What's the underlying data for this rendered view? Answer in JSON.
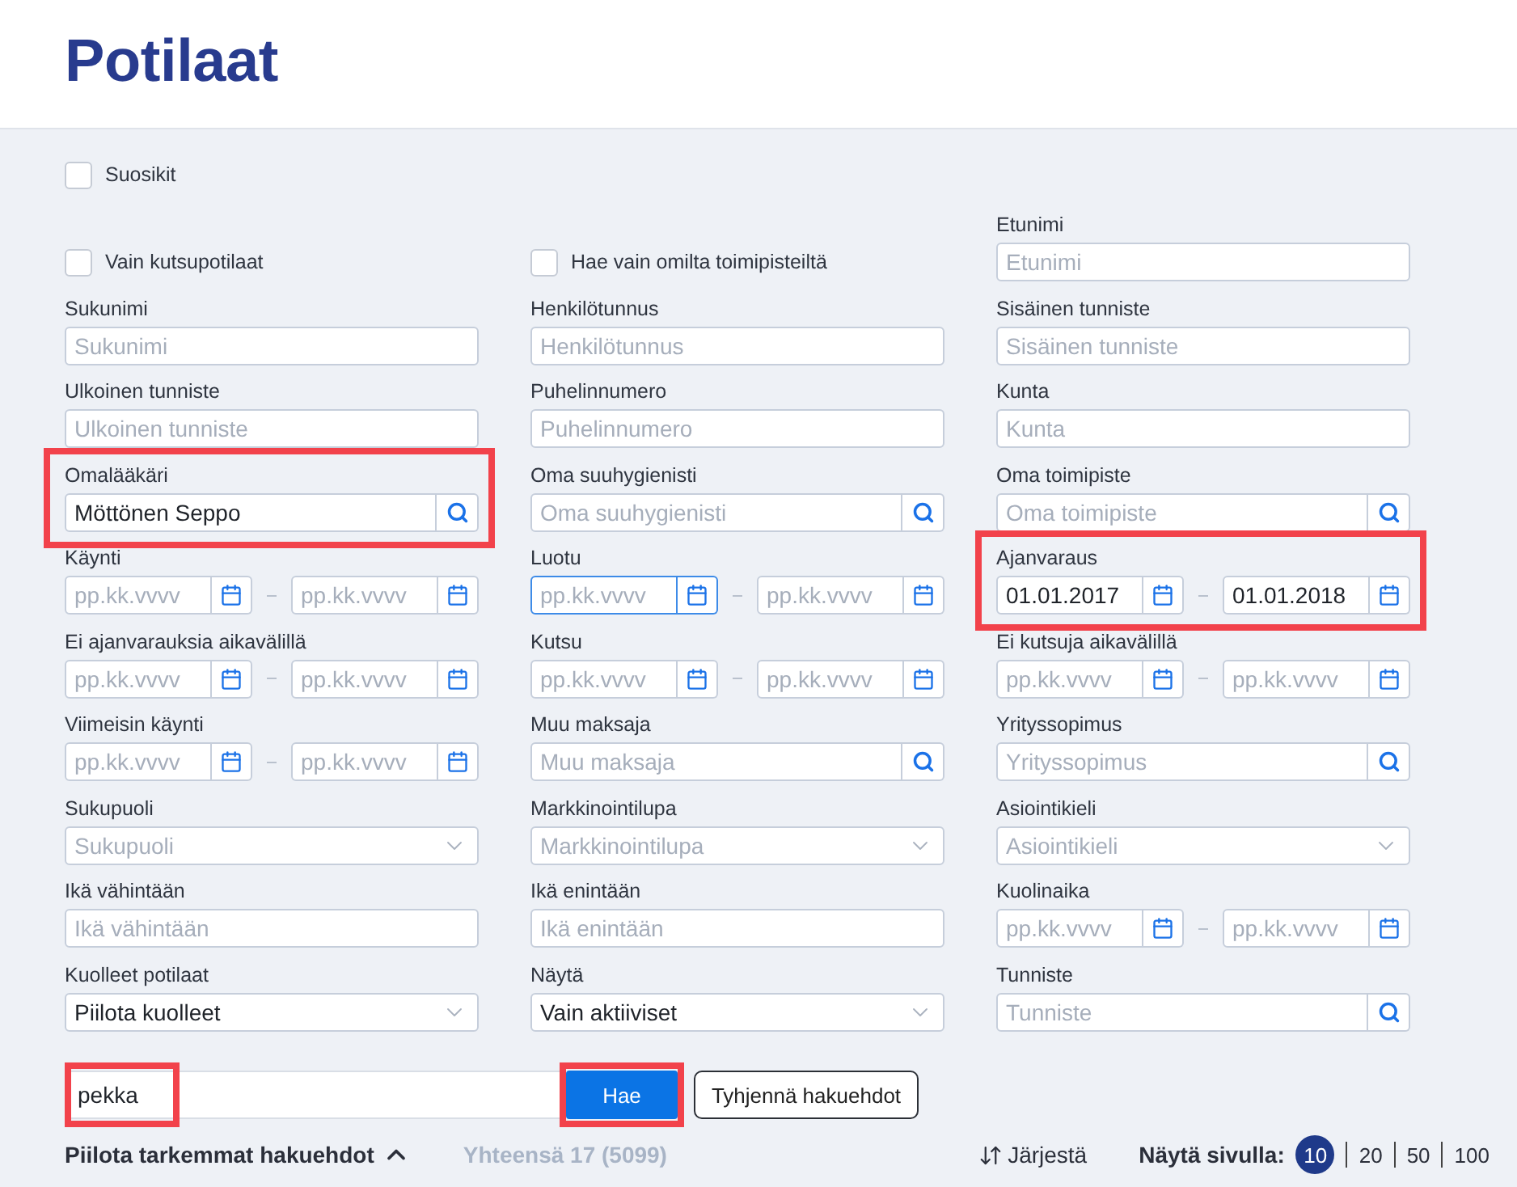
{
  "header": {
    "title": "Potilaat"
  },
  "filters": {
    "rows": [
      [
        {
          "kind": "checkbox",
          "label": "Suosikit",
          "checked": false,
          "highlighted": false
        }
      ],
      [
        {
          "kind": "checkbox",
          "label": "Vain kutsupotilaat",
          "checked": false,
          "highlighted": false
        },
        {
          "kind": "checkbox",
          "label": "Hae vain omilta toimipisteiltä",
          "checked": false,
          "highlighted": false
        },
        {
          "kind": "text",
          "label": "Etunimi",
          "placeholder": "Etunimi",
          "highlighted": false
        }
      ],
      [
        {
          "kind": "text",
          "label": "Sukunimi",
          "placeholder": "Sukunimi",
          "highlighted": false
        },
        {
          "kind": "text",
          "label": "Henkilötunnus",
          "placeholder": "Henkilötunnus",
          "highlighted": false
        },
        {
          "kind": "text",
          "label": "Sisäinen tunniste",
          "placeholder": "Sisäinen tunniste",
          "highlighted": false
        }
      ],
      [
        {
          "kind": "text",
          "label": "Ulkoinen tunniste",
          "placeholder": "Ulkoinen tunniste",
          "highlighted": false
        },
        {
          "kind": "text",
          "label": "Puhelinnumero",
          "placeholder": "Puhelinnumero",
          "highlighted": false
        },
        {
          "kind": "text",
          "label": "Kunta",
          "placeholder": "Kunta",
          "highlighted": false
        }
      ],
      [
        {
          "kind": "search",
          "label": "Omalääkäri",
          "value": "Möttönen Seppo",
          "highlighted": true
        },
        {
          "kind": "search",
          "label": "Oma suuhygienisti",
          "placeholder": "Oma suuhygienisti",
          "highlighted": false
        },
        {
          "kind": "search",
          "label": "Oma toimipiste",
          "placeholder": "Oma toimipiste",
          "highlighted": false
        }
      ],
      [
        {
          "kind": "date_range",
          "label": "Käynti",
          "from": {
            "placeholder": "pp.kk.vvvv",
            "focused": false
          },
          "to": {
            "placeholder": "pp.kk.vvvv",
            "focused": false
          },
          "highlighted": false
        },
        {
          "kind": "date_range",
          "label": "Luotu",
          "from": {
            "placeholder": "pp.kk.vvvv",
            "focused": true
          },
          "to": {
            "placeholder": "pp.kk.vvvv",
            "focused": false
          },
          "highlighted": false
        },
        {
          "kind": "date_range",
          "label": "Ajanvaraus",
          "from": {
            "value": "01.01.2017",
            "focused": false
          },
          "to": {
            "value": "01.01.2018",
            "focused": false
          },
          "highlighted": true
        }
      ],
      [
        {
          "kind": "date_range",
          "label": "Ei ajanvarauksia aikavälillä",
          "from": {
            "placeholder": "pp.kk.vvvv",
            "focused": false
          },
          "to": {
            "placeholder": "pp.kk.vvvv",
            "focused": false
          },
          "highlighted": false
        },
        {
          "kind": "date_range",
          "label": "Kutsu",
          "from": {
            "placeholder": "pp.kk.vvvv",
            "focused": false
          },
          "to": {
            "placeholder": "pp.kk.vvvv",
            "focused": false
          },
          "highlighted": false
        },
        {
          "kind": "date_range",
          "label": "Ei kutsuja aikavälillä",
          "from": {
            "placeholder": "pp.kk.vvvv",
            "focused": false
          },
          "to": {
            "placeholder": "pp.kk.vvvv",
            "focused": false
          },
          "highlighted": false
        }
      ],
      [
        {
          "kind": "date_range",
          "label": "Viimeisin käynti",
          "from": {
            "placeholder": "pp.kk.vvvv",
            "focused": false
          },
          "to": {
            "placeholder": "pp.kk.vvvv",
            "focused": false
          },
          "highlighted": false
        },
        {
          "kind": "search",
          "label": "Muu maksaja",
          "placeholder": "Muu maksaja",
          "highlighted": false
        },
        {
          "kind": "search",
          "label": "Yrityssopimus",
          "placeholder": "Yrityssopimus",
          "highlighted": false
        }
      ],
      [
        {
          "kind": "select",
          "label": "Sukupuoli",
          "placeholder": "Sukupuoli",
          "highlighted": false
        },
        {
          "kind": "select",
          "label": "Markkinointilupa",
          "placeholder": "Markkinointilupa",
          "highlighted": false
        },
        {
          "kind": "select",
          "label": "Asiointikieli",
          "placeholder": "Asiointikieli",
          "highlighted": false
        }
      ],
      [
        {
          "kind": "text",
          "label": "Ikä vähintään",
          "placeholder": "Ikä vähintään",
          "highlighted": false
        },
        {
          "kind": "text",
          "label": "Ikä enintään",
          "placeholder": "Ikä enintään",
          "highlighted": false
        },
        {
          "kind": "date_range",
          "label": "Kuolinaika",
          "from": {
            "placeholder": "pp.kk.vvvv",
            "focused": false
          },
          "to": {
            "placeholder": "pp.kk.vvvv",
            "focused": false
          },
          "highlighted": false
        }
      ],
      [
        {
          "kind": "select",
          "label": "Kuolleet potilaat",
          "value": "Piilota kuolleet",
          "highlighted": false
        },
        {
          "kind": "select",
          "label": "Näytä",
          "value": "Vain aktiiviset",
          "highlighted": false
        },
        {
          "kind": "search",
          "label": "Tunniste",
          "placeholder": "Tunniste",
          "highlighted": false
        }
      ]
    ]
  },
  "search_bar": {
    "value": "pekka",
    "highlighted": true,
    "buttons": [
      {
        "kind": "primary",
        "label": "Hae",
        "highlighted": true
      },
      {
        "kind": "secondary",
        "label": "Tyhjennä hakuehdot",
        "highlighted": false
      }
    ]
  },
  "footer": {
    "toggle": {
      "label": "Piilota tarkemmat hakuehdot",
      "expanded": true
    },
    "total": "Yhteensä 17 (5099)",
    "sort": {
      "label": "Järjestä"
    },
    "page_size": {
      "label": "Näytä sivulla:",
      "options": [
        {
          "label": "10",
          "selected": true
        },
        {
          "label": "20",
          "selected": false
        },
        {
          "label": "50",
          "selected": false
        },
        {
          "label": "100",
          "selected": false
        }
      ]
    }
  }
}
